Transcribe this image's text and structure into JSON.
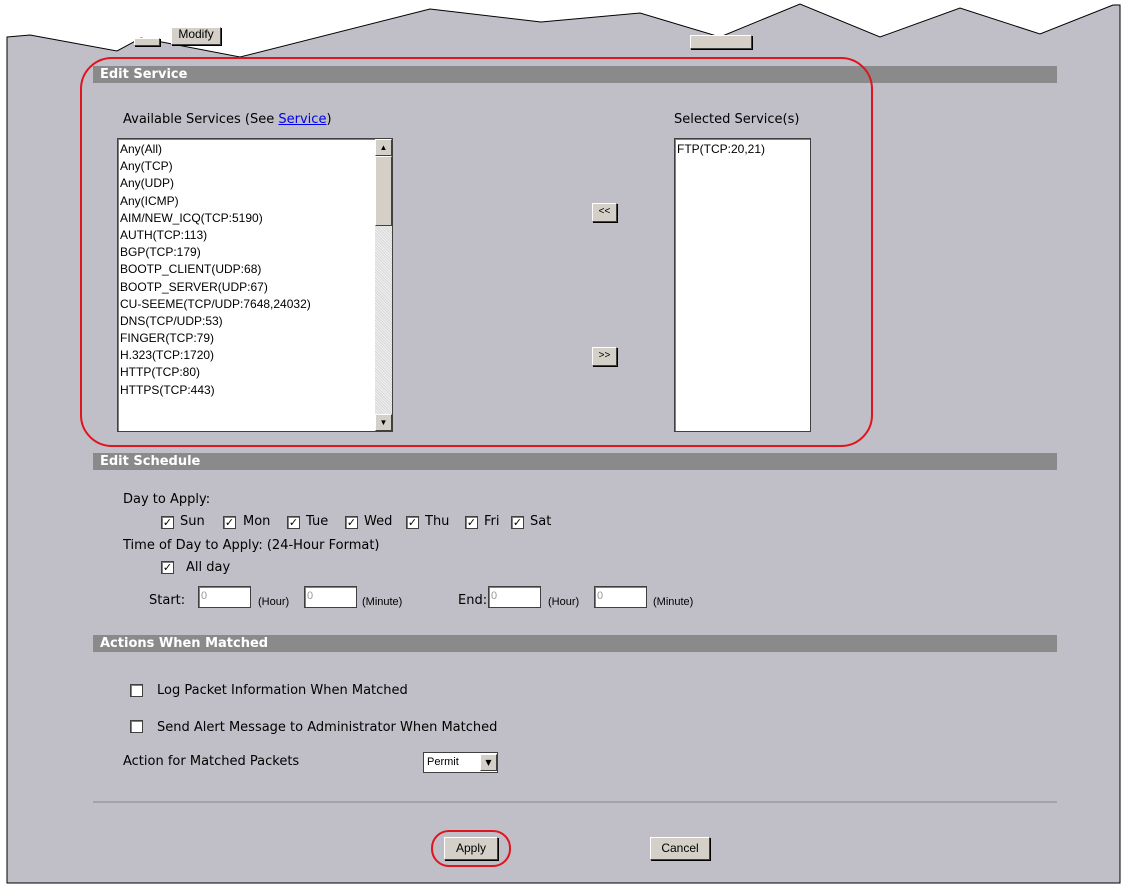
{
  "top_buttons": {
    "modify_label": "Modify"
  },
  "edit_service": {
    "header": "Edit Service",
    "available_label": "Available Services  (See ",
    "available_link": "Service",
    "available_suffix": ")",
    "selected_label": "Selected Service(s)",
    "available_items": [
      "Any(All)",
      "Any(TCP)",
      "Any(UDP)",
      "Any(ICMP)",
      "AIM/NEW_ICQ(TCP:5190)",
      "AUTH(TCP:113)",
      "BGP(TCP:179)",
      "BOOTP_CLIENT(UDP:68)",
      "BOOTP_SERVER(UDP:67)",
      "CU-SEEME(TCP/UDP:7648,24032)",
      "DNS(TCP/UDP:53)",
      "FINGER(TCP:79)",
      "H.323(TCP:1720)",
      "HTTP(TCP:80)",
      "HTTPS(TCP:443)"
    ],
    "selected_items": [
      "FTP(TCP:20,21)"
    ],
    "add_label": "<<",
    "remove_label": ">>"
  },
  "edit_schedule": {
    "header": "Edit Schedule",
    "day_label": "Day to Apply:",
    "days": [
      {
        "label": "Sun",
        "checked": true
      },
      {
        "label": "Mon",
        "checked": true
      },
      {
        "label": "Tue",
        "checked": true
      },
      {
        "label": "Wed",
        "checked": true
      },
      {
        "label": "Thu",
        "checked": true
      },
      {
        "label": "Fri",
        "checked": true
      },
      {
        "label": "Sat",
        "checked": true
      }
    ],
    "time_label": "Time of Day to Apply: (24-Hour Format)",
    "all_day_label": "All day",
    "all_day_checked": true,
    "start_label": "Start:",
    "end_label": "End:",
    "hour_unit": "(Hour)",
    "minute_unit": "(Minute)",
    "start_hour": "0",
    "start_minute": "0",
    "end_hour": "0",
    "end_minute": "0"
  },
  "actions": {
    "header": "Actions When Matched",
    "log_label": "Log Packet Information When Matched",
    "alert_label": "Send Alert Message to Administrator When Matched",
    "matched_label": "Action for Matched Packets",
    "action_value": "Permit"
  },
  "footer": {
    "apply_label": "Apply",
    "cancel_label": "Cancel"
  },
  "colors": {
    "panel_bg": "#c0bfc7",
    "header_bar": "#8a8a8a",
    "highlight": "#e0141e",
    "link": "#0000ee"
  }
}
